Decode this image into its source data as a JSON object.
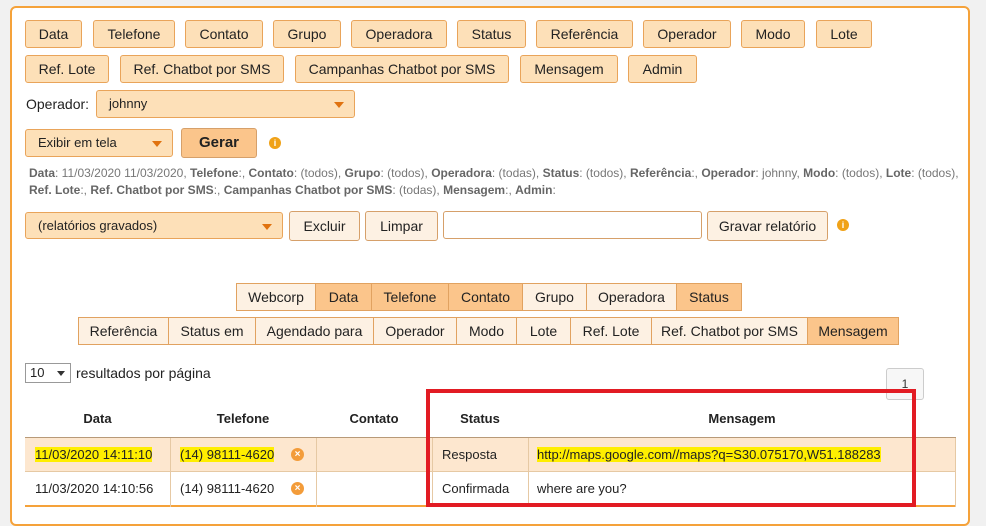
{
  "filter_chips": [
    "Data",
    "Telefone",
    "Contato",
    "Grupo",
    "Operadora",
    "Status",
    "Referência",
    "Operador",
    "Modo",
    "Lote",
    "Ref. Lote",
    "Ref. Chatbot por SMS",
    "Campanhas Chatbot por SMS",
    "Mensagem",
    "Admin"
  ],
  "operator": {
    "label": "Operador:",
    "value": "johnny"
  },
  "display": {
    "value": "Exibir em tela",
    "generate_label": "Gerar"
  },
  "summary": {
    "parts": [
      [
        "Data",
        ": 11/03/2020 11/03/2020, "
      ],
      [
        "Telefone",
        ":, "
      ],
      [
        "Contato",
        ": (todos), "
      ],
      [
        "Grupo",
        ": (todos), "
      ],
      [
        "Operadora",
        ": (todas), "
      ],
      [
        "Status",
        ": (todos), "
      ],
      [
        "Referência",
        ":, "
      ],
      [
        "Operador",
        ": johnny, "
      ],
      [
        "Modo",
        ": (todos), "
      ],
      [
        "Lote",
        ": (todos), "
      ],
      [
        "Ref. Lote",
        ":, "
      ],
      [
        "Ref. Chatbot por SMS",
        ":, "
      ],
      [
        "Campanhas Chatbot por SMS",
        ": (todas), "
      ],
      [
        "Mensagem",
        ":, "
      ],
      [
        "Admin",
        ":"
      ]
    ]
  },
  "saved": {
    "select_value": "(relatórios gravados)",
    "delete_label": "Excluir",
    "clear_label": "Limpar",
    "name_value": "",
    "save_label": "Gravar relatório"
  },
  "column_toggles_row1": [
    {
      "label": "Webcorp",
      "on": false
    },
    {
      "label": "Data",
      "on": true
    },
    {
      "label": "Telefone",
      "on": true
    },
    {
      "label": "Contato",
      "on": true
    },
    {
      "label": "Grupo",
      "on": false
    },
    {
      "label": "Operadora",
      "on": false
    },
    {
      "label": "Status",
      "on": true
    }
  ],
  "column_toggles_row2": [
    {
      "label": "Referência",
      "on": false
    },
    {
      "label": "Status em",
      "on": false
    },
    {
      "label": "Agendado para",
      "on": false
    },
    {
      "label": "Operador",
      "on": false
    },
    {
      "label": "Modo",
      "on": false
    },
    {
      "label": "Lote",
      "on": false
    },
    {
      "label": "Ref. Lote",
      "on": false
    },
    {
      "label": "Ref. Chatbot por SMS",
      "on": false
    },
    {
      "label": "Mensagem",
      "on": true
    }
  ],
  "paging": {
    "per_page": "10",
    "per_page_label": "resultados por página",
    "page": "1"
  },
  "table": {
    "headers": [
      "Data",
      "Telefone",
      "Contato",
      "Status",
      "Mensagem"
    ],
    "rows": [
      {
        "data": "11/03/2020 14:11:10",
        "telefone": "(14) 98111-4620",
        "contato": "",
        "status": "Resposta",
        "mensagem": "http://maps.google.com//maps?q=S30.075170,W51.188283",
        "highlight": true
      },
      {
        "data": "11/03/2020 14:10:56",
        "telefone": "(14) 98111-4620",
        "contato": "",
        "status": "Confirmada",
        "mensagem": "where are you?",
        "highlight": false
      }
    ]
  },
  "colors": {
    "accent": "#f5a23a",
    "chip": "#fde0b8",
    "highlight": "#ffee00",
    "annotation": "#e21b23"
  }
}
